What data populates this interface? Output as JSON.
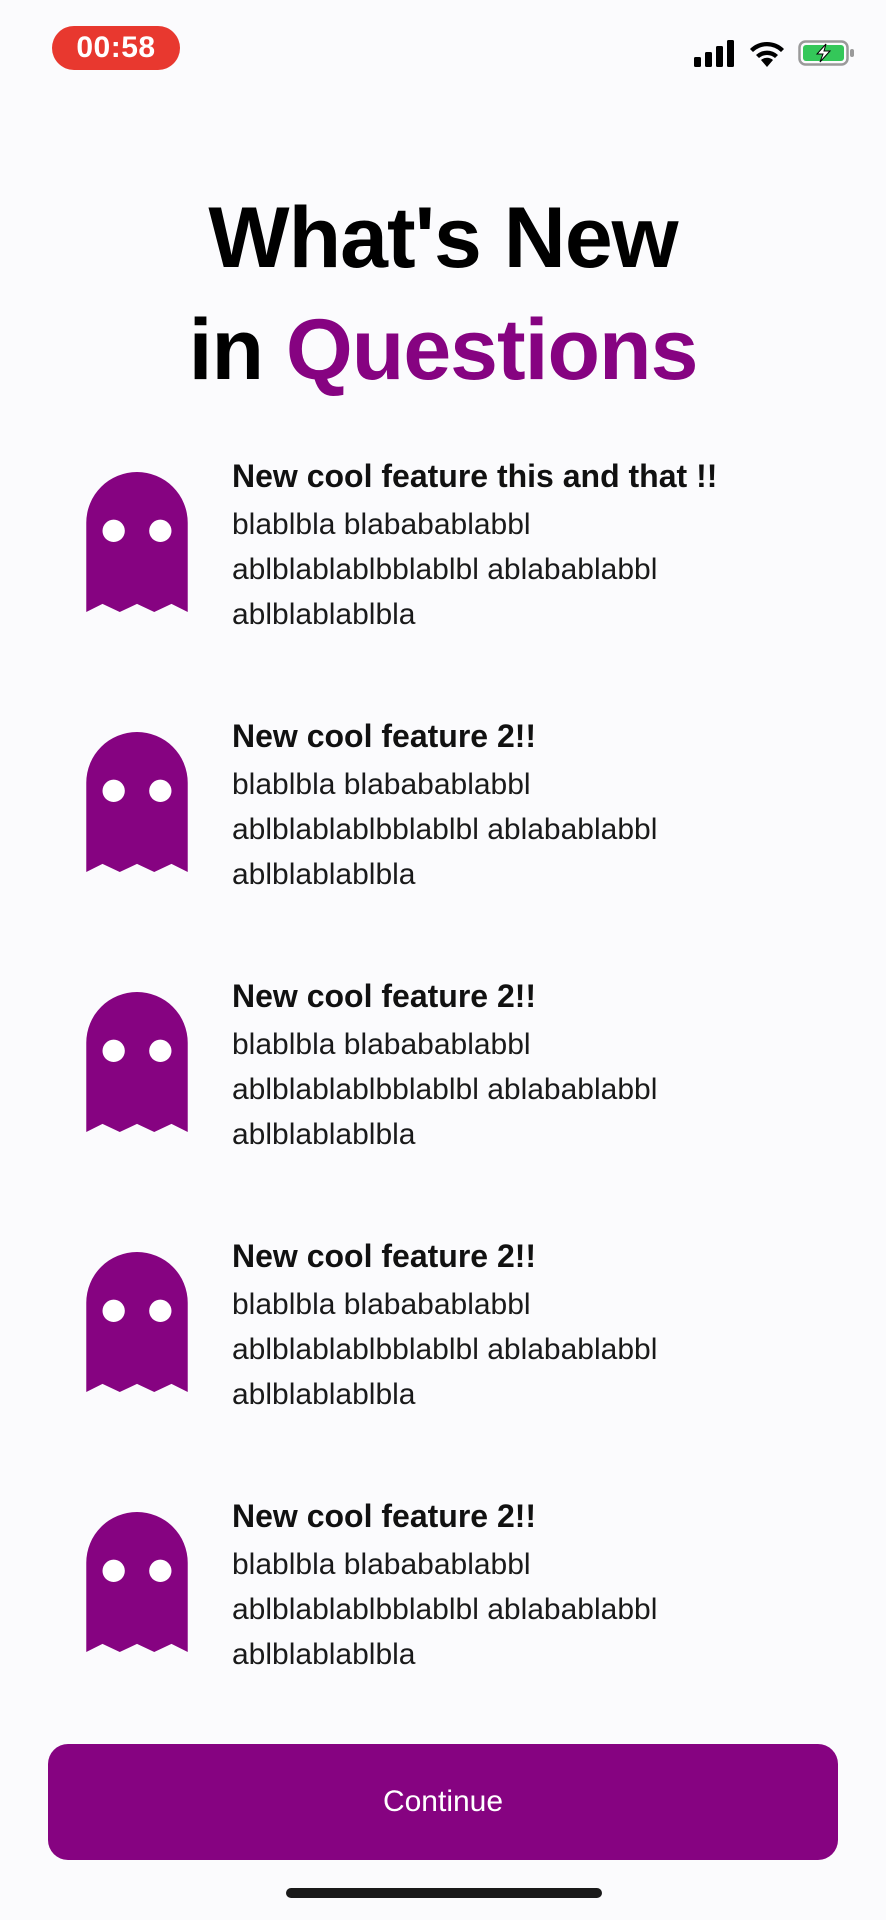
{
  "status_bar": {
    "time": "00:58",
    "icons": [
      "cellular-signal-icon",
      "wifi-icon",
      "battery-charging-icon"
    ]
  },
  "header": {
    "title_line1": "What's New",
    "title_line2_prefix": "in",
    "title_line2_accent": "Questions"
  },
  "features": [
    {
      "icon": "ghost-icon",
      "title": "New cool feature this and that !!",
      "description": "blablbla blababablabbl ablblablablbblablbl ablabablabbl ablblablablbla"
    },
    {
      "icon": "ghost-icon",
      "title": "New cool feature 2!!",
      "description": "blablbla blababablabbl ablblablablbblablbl ablabablabbl ablblablablbla"
    },
    {
      "icon": "ghost-icon",
      "title": "New cool feature 2!!",
      "description": "blablbla blababablabbl ablblablablbblablbl ablabablabbl ablblablablbla"
    },
    {
      "icon": "ghost-icon",
      "title": "New cool feature 2!!",
      "description": "blablbla blababablabbl ablblablablbblablbl ablabablabbl ablblablablbla"
    },
    {
      "icon": "ghost-icon",
      "title": "New cool feature 2!!",
      "description": "blablbla blababablabbl ablblablablbblablbl ablabablabbl ablblablablbla"
    }
  ],
  "continue_button": {
    "label": "Continue"
  },
  "colors": {
    "accent": "#860381",
    "status_time_bg": "#e8382f",
    "battery_fill": "#34c759"
  }
}
